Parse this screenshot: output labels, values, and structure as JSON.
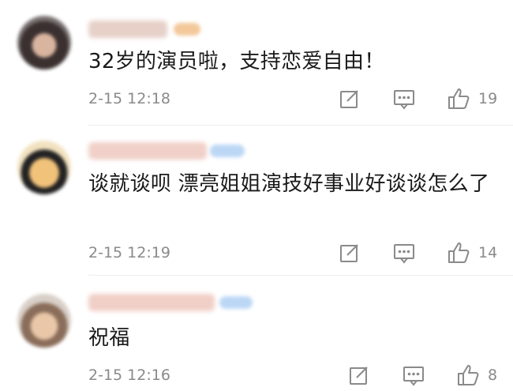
{
  "comments": [
    {
      "text": "32岁的演员啦，支持恋爱自由！",
      "time": "2-15 12:18",
      "likes": "19"
    },
    {
      "text": "谈就谈呗 漂亮姐姐演技好事业好谈谈怎么了",
      "time": "2-15 12:19",
      "likes": "14"
    },
    {
      "text": "祝福",
      "time": "2-15 12:16",
      "likes": "8"
    }
  ],
  "icons": {
    "edit": "edit-icon",
    "comment": "comment-icon",
    "like": "thumbs-up-icon"
  }
}
